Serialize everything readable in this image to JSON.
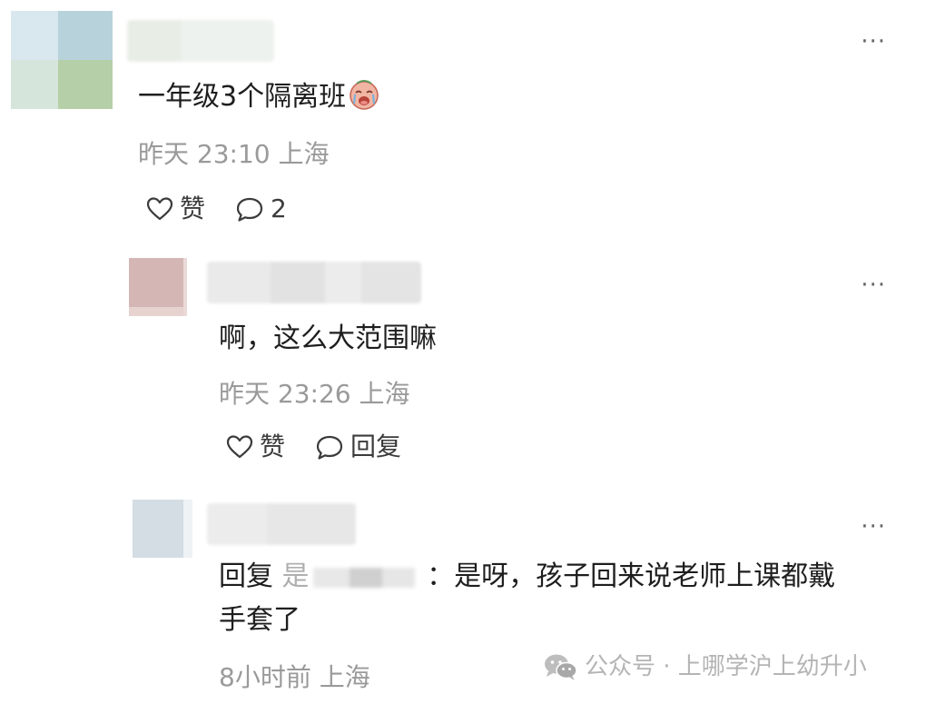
{
  "comments": [
    {
      "text": "一年级3个隔离班",
      "emoji": "crying-face-emoji",
      "meta": "昨天 23:10 上海",
      "like_label": "赞",
      "reply_label": "2"
    },
    {
      "text": "啊，这么大范围嘛",
      "meta": "昨天 23:26 上海",
      "like_label": "赞",
      "reply_label": "回复"
    },
    {
      "reply_prefix": "回复",
      "name_lead": "是",
      "text_after": "：是呀，孩子回来说老师上课都戴",
      "text_line2": "手套了",
      "meta": "8小时前 上海"
    }
  ],
  "more_label": "···",
  "watermark": {
    "icon": "wechat-icon",
    "text": "公众号 · 上哪学沪上幼升小"
  }
}
